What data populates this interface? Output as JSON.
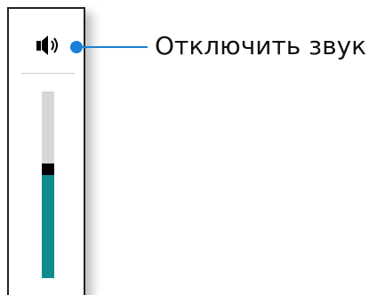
{
  "volume_control": {
    "mute_button_icon": "speaker-icon",
    "level_percent": 55,
    "colors": {
      "fill": "#0f8a8f",
      "track": "#d6d6d6",
      "thumb": "#000000",
      "callout": "#1a7fd6"
    }
  },
  "callout": {
    "label": "Отключить звук"
  }
}
